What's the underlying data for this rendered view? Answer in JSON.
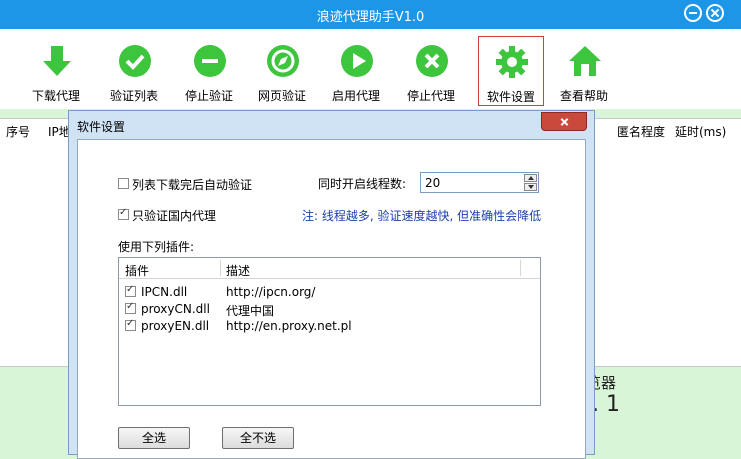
{
  "window": {
    "title": "浪迹代理助手V1.0"
  },
  "toolbar": {
    "download": "下载代理",
    "verify_list": "验证列表",
    "stop_verify": "停止验证",
    "web_verify": "网页验证",
    "enable_proxy": "启用代理",
    "stop_proxy": "停止代理",
    "settings": "软件设置",
    "help": "查看帮助"
  },
  "list": {
    "columns": {
      "index": "序号",
      "ip": "IP地",
      "anonymity": "匿名程度",
      "delay": "延时(ms)"
    }
  },
  "background": {
    "line1": "览器",
    "line2": ". 1"
  },
  "dialog": {
    "title": "软件设置",
    "auto_verify_label": "列表下载完后自动验证",
    "auto_verify_checked": false,
    "thread_label": "同时开启线程数:",
    "thread_value": "20",
    "domestic_only_label": "只验证国内代理",
    "domestic_only_checked": true,
    "thread_note": "注: 线程越多, 验证速度越快, 但准确性会降低",
    "plugins_label": "使用下列插件:",
    "plugin_columns": {
      "name": "插件",
      "desc": "描述"
    },
    "plugins": [
      {
        "name": "IPCN.dll",
        "desc": "http://ipcn.org/",
        "checked": true
      },
      {
        "name": "proxyCN.dll",
        "desc": "代理中国",
        "checked": true
      },
      {
        "name": "proxyEN.dll",
        "desc": "http://en.proxy.net.pl",
        "checked": true
      }
    ],
    "select_all": "全选",
    "select_none": "全不选"
  },
  "colors": {
    "titlebar": "#1d96e8",
    "icon_green": "#3ec53e",
    "dialog_close": "#c94a3c",
    "note_blue": "#1a3fb0"
  }
}
